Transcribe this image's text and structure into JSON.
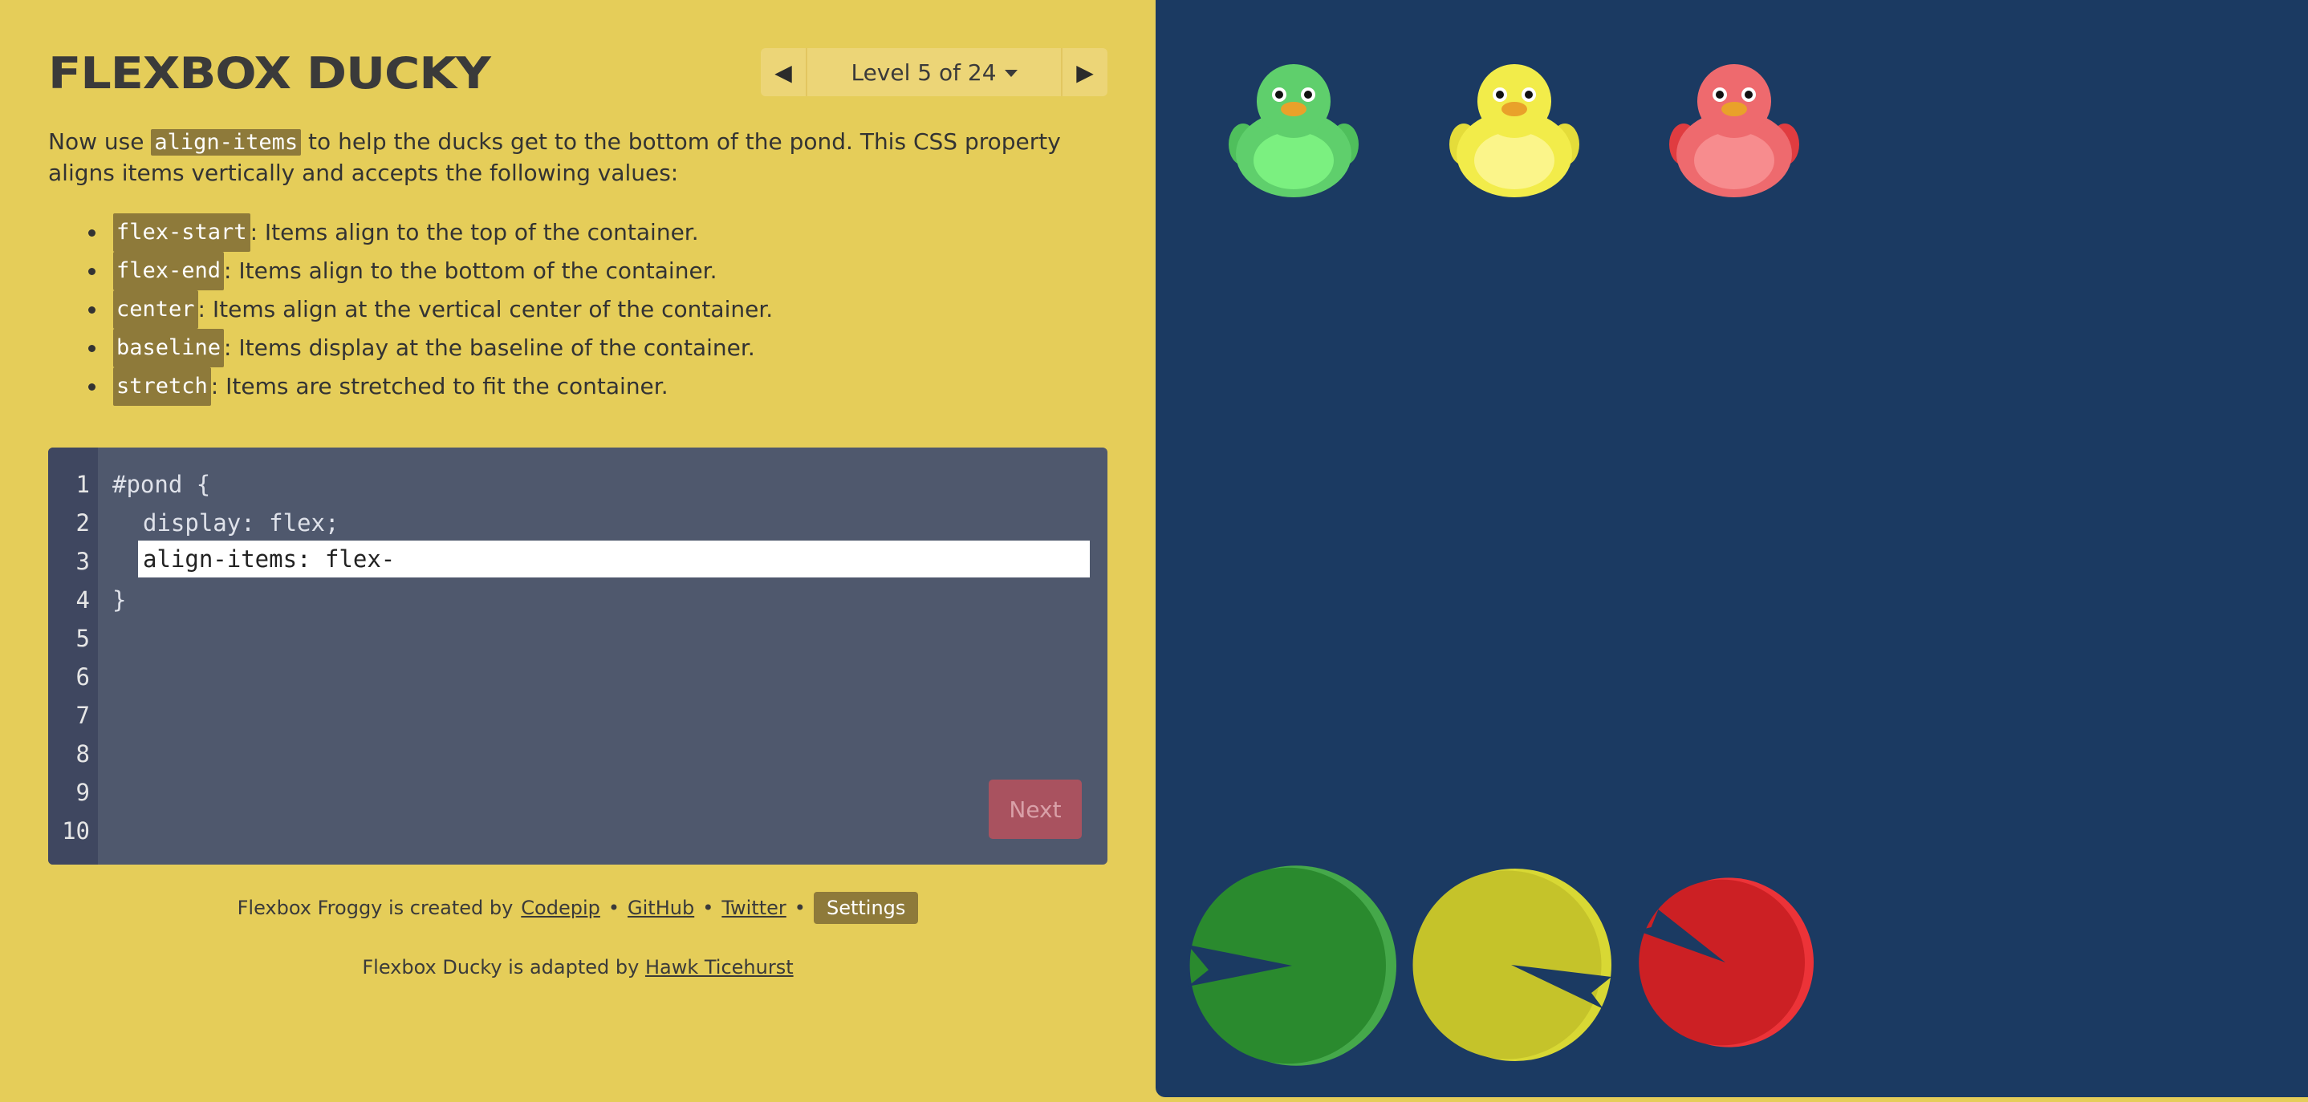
{
  "header": {
    "title": "FLEXBOX DUCKY",
    "level_label": "Level 5 of 24"
  },
  "instructions": {
    "part1": "Now use ",
    "property": "align-items",
    "part2": " to help the ducks get to the bottom of the pond. This CSS property aligns items vertically and accepts the following values:",
    "values": [
      {
        "code": "flex-start",
        "desc": ": Items align to the top of the container."
      },
      {
        "code": "flex-end",
        "desc": ": Items align to the bottom of the container."
      },
      {
        "code": "center",
        "desc": ": Items align at the vertical center of the container."
      },
      {
        "code": "baseline",
        "desc": ": Items display at the baseline of the container."
      },
      {
        "code": "stretch",
        "desc": ": Items are stretched to fit the container."
      }
    ]
  },
  "editor": {
    "line_numbers": [
      "1",
      "2",
      "3",
      "4",
      "5",
      "6",
      "7",
      "8",
      "9",
      "10"
    ],
    "line1": "#pond {",
    "line2": "display: flex;",
    "input_value": "align-items: flex-",
    "line4": "}",
    "next_label": "Next"
  },
  "footer": {
    "created_prefix": "Flexbox Froggy is created by",
    "codepip": "Codepip",
    "github": "GitHub",
    "twitter": "Twitter",
    "sep": "•",
    "settings": "Settings",
    "adapted_prefix": "Flexbox Ducky is adapted by",
    "author": "Hawk Ticehurst"
  },
  "pond": {
    "ducks": [
      {
        "color": "green",
        "body": "#5fcf6c",
        "belly": "#7bf080",
        "wing": "#4fbf5c"
      },
      {
        "color": "yellow",
        "body": "#f2ec4a",
        "belly": "#fbf58a",
        "wing": "#e4dc3a"
      },
      {
        "color": "red",
        "body": "#ee6a6e",
        "belly": "#f78c8e",
        "wing": "#e03c40"
      }
    ],
    "lilypads": [
      {
        "color": "green",
        "main": "#2a8a2e",
        "rim": "#45a84a"
      },
      {
        "color": "yellow",
        "main": "#c5c32a",
        "rim": "#d8d834"
      },
      {
        "color": "red",
        "main": "#cc2024",
        "rim": "#ec3338"
      }
    ]
  },
  "colors": {
    "background": "#e5cd59",
    "pond": "#1b3a62",
    "editor": "#4f586d",
    "code_highlight": "#8e7a3a"
  }
}
